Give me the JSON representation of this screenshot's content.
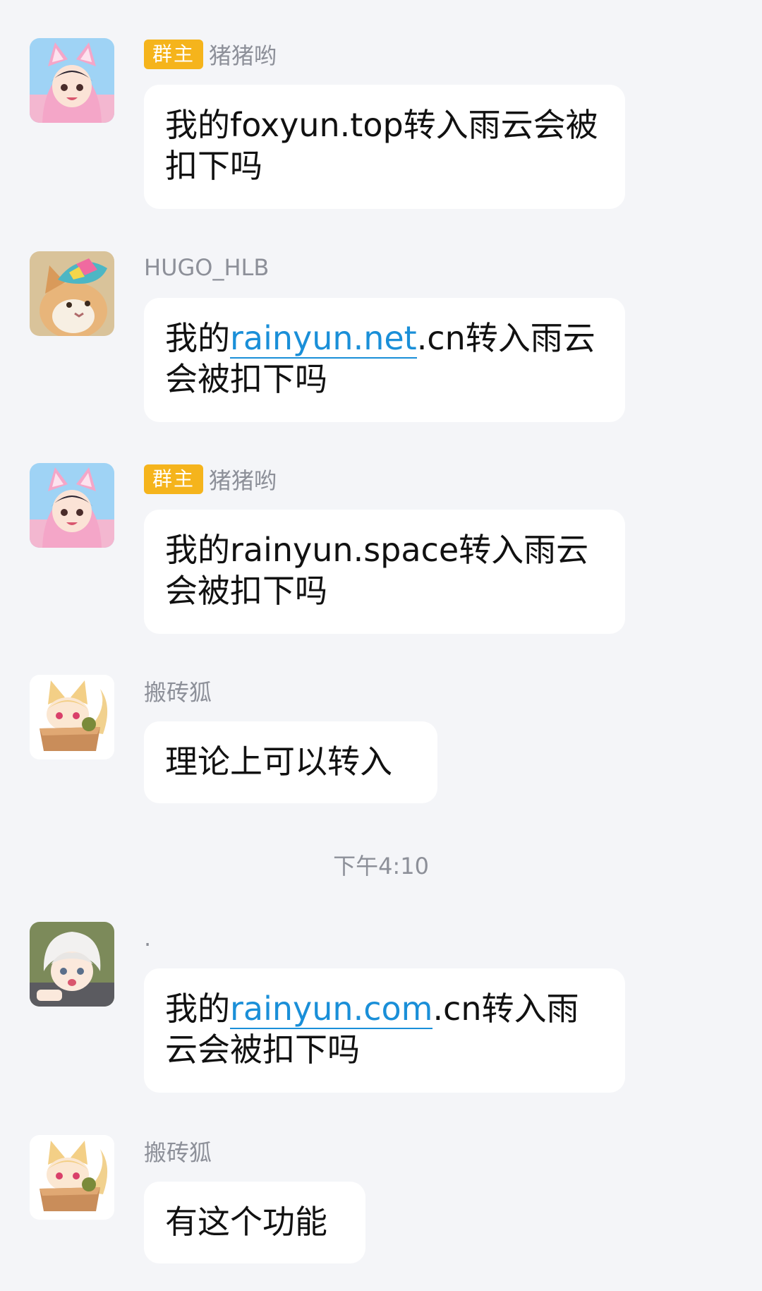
{
  "messages": [
    {
      "avatar": "avatar-pink-cat-girl-icon",
      "badge": "群主",
      "sender": "猪猪哟",
      "text_before": "我的foxyun.top转入雨云会被扣下吗",
      "link": "",
      "text_after": ""
    },
    {
      "avatar": "avatar-cat-with-cap-icon",
      "badge": "",
      "sender": "HUGO_HLB",
      "text_before": "我的",
      "link": "rainyun.net",
      "text_after": ".cn转入雨云会被扣下吗"
    },
    {
      "avatar": "avatar-pink-cat-girl-icon",
      "badge": "群主",
      "sender": "猪猪哟",
      "text_before": "我的rainyun.space转入雨云会被扣下吗",
      "link": "",
      "text_after": ""
    },
    {
      "avatar": "avatar-fox-in-box-icon",
      "badge": "",
      "sender": "搬砖狐",
      "text_before": "理论上可以转入",
      "link": "",
      "text_after": ""
    },
    {
      "avatar": "avatar-white-hair-boy-icon",
      "badge": "",
      "sender": ".",
      "text_before": "我的",
      "link": "rainyun.com",
      "text_after": ".cn转入雨云会被扣下吗"
    },
    {
      "avatar": "avatar-fox-in-box-icon",
      "badge": "",
      "sender": "搬砖狐",
      "text_before": "有这个功能",
      "link": "",
      "text_after": ""
    }
  ],
  "timestamp": "下午4:10",
  "colors": {
    "background": "#f4f5f8",
    "bubble": "#ffffff",
    "badge": "#f5b41c",
    "link": "#1a8fd8",
    "meta_text": "#8d9099"
  }
}
